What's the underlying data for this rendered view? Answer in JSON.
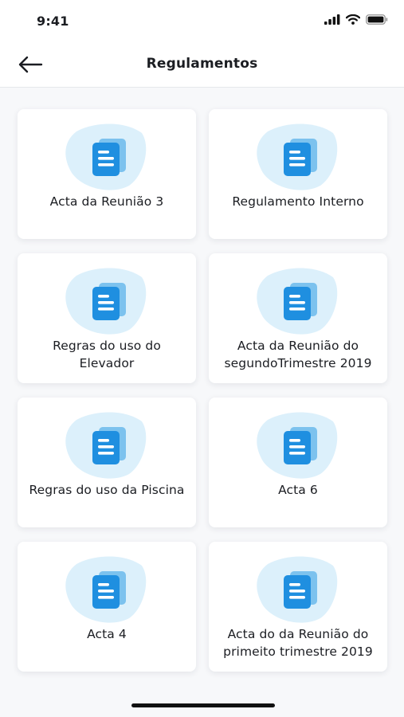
{
  "status_bar": {
    "time": "9:41"
  },
  "header": {
    "title": "Regulamentos"
  },
  "documents": [
    {
      "label": "Acta da Reunião 3"
    },
    {
      "label": "Regulamento Interno"
    },
    {
      "label": "Regras do uso do Elevador"
    },
    {
      "label": "Acta da Reunião do segundoTrimestre 2019"
    },
    {
      "label": "Regras do uso da Piscina"
    },
    {
      "label": "Acta 6"
    },
    {
      "label": "Acta 4"
    },
    {
      "label": "Acta do da Reunião do primeito trimestre 2019"
    }
  ],
  "icons": {
    "back": "arrow-left-icon",
    "document": "document-icon",
    "signal": "signal-icon",
    "wifi": "wifi-icon",
    "battery": "battery-icon"
  },
  "colors": {
    "accent": "#1f8fe0",
    "accent_light": "#dcf0fb",
    "text": "#1b1d22",
    "background": "#f7f8fa"
  }
}
